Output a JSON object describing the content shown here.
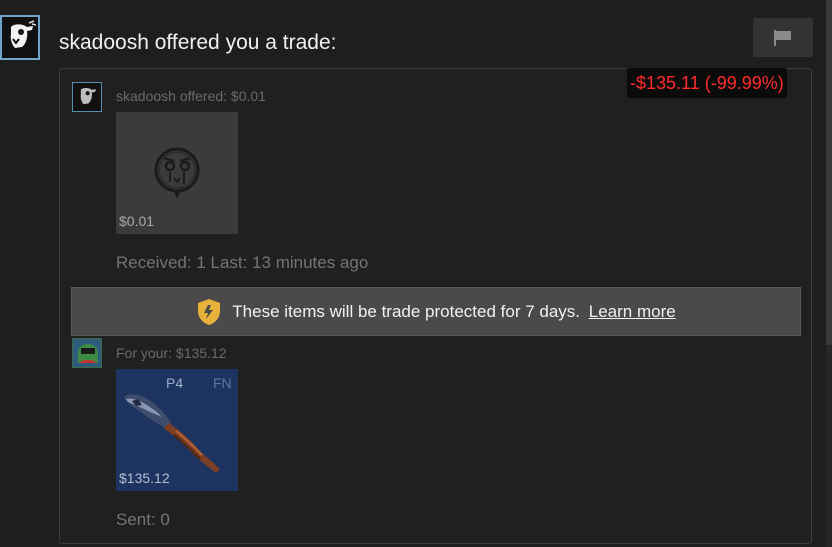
{
  "header": {
    "title": "skadoosh offered you a trade:",
    "report_icon": "flag-icon"
  },
  "value_change": {
    "text": "-$135.11 (-99.99%)",
    "color": "#ff2b2b"
  },
  "them": {
    "offer_label": "skadoosh offered: $0.01",
    "avatar_icon": "bird-avatar-icon",
    "item": {
      "icon": "crying-face-sticker-icon",
      "price": "$0.01"
    },
    "status": "Received: 1 Last: 13 minutes ago"
  },
  "protection": {
    "icon": "shield-lightning-icon",
    "text": "These items will be trade protected for 7 days.",
    "link": "Learn more",
    "shield_color": "#e8b23a"
  },
  "you": {
    "offer_label": "For your: $135.12",
    "avatar_icon": "pepe-avatar-icon",
    "item": {
      "icon": "knife-icon",
      "pattern": "P4",
      "wear": "FN",
      "price": "$135.12"
    },
    "status": "Sent: 0"
  }
}
